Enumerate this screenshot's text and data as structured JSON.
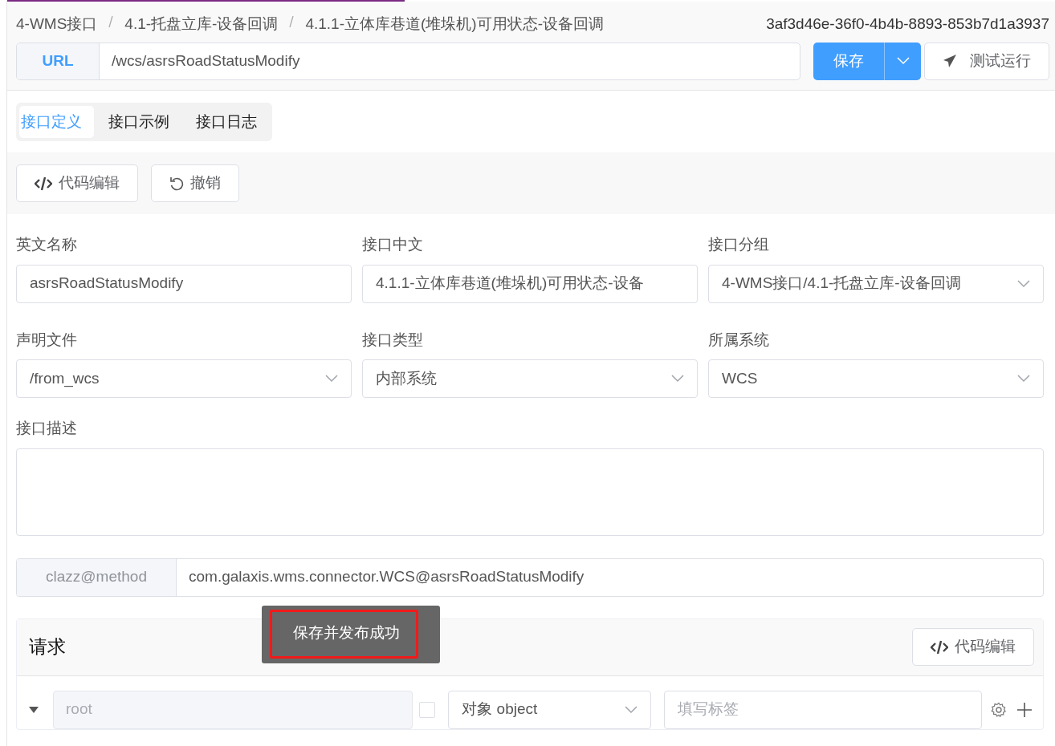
{
  "breadcrumb": [
    "4-WMS接口",
    "4.1-托盘立库-设备回调",
    "4.1.1-立体库巷道(堆垛机)可用状态-设备回调"
  ],
  "uuid": "3af3d46e-36f0-4b4b-8893-853b7d1a3937",
  "url": {
    "label": "URL",
    "value": "/wcs/asrsRoadStatusModify"
  },
  "actions": {
    "save": "保存",
    "test_run": "测试运行"
  },
  "tabs": [
    {
      "label": "接口定义",
      "selected": true
    },
    {
      "label": "接口示例",
      "selected": false
    },
    {
      "label": "接口日志",
      "selected": false
    }
  ],
  "toolbar": [
    {
      "label": "代码编辑"
    },
    {
      "label": "撤销"
    }
  ],
  "fields": [
    {
      "label": "英文名称",
      "kind": "text",
      "value": "asrsRoadStatusModify"
    },
    {
      "label": "接口中文",
      "kind": "text",
      "value": "4.1.1-立体库巷道(堆垛机)可用状态-设备"
    },
    {
      "label": "接口分组",
      "kind": "select",
      "value": "4-WMS接口/4.1-托盘立库-设备回调"
    },
    {
      "label": "声明文件",
      "kind": "select",
      "value": "/from_wcs"
    },
    {
      "label": "接口类型",
      "kind": "select",
      "value": "内部系统"
    },
    {
      "label": "所属系统",
      "kind": "select",
      "value": "WCS"
    }
  ],
  "description": {
    "label": "接口描述"
  },
  "clazz_method": {
    "label": "clazz@method",
    "value": "com.galaxis.wms.connector.WCS@asrsRoadStatusModify"
  },
  "request": {
    "title": "请求",
    "code_button": "代码编辑",
    "root_row": {
      "expanded": true,
      "name": "root",
      "required": false,
      "type": "对象 object",
      "tag_placeholder": "填写标签"
    }
  },
  "toast": {
    "text": "保存并发布成功",
    "highlighted": true
  }
}
